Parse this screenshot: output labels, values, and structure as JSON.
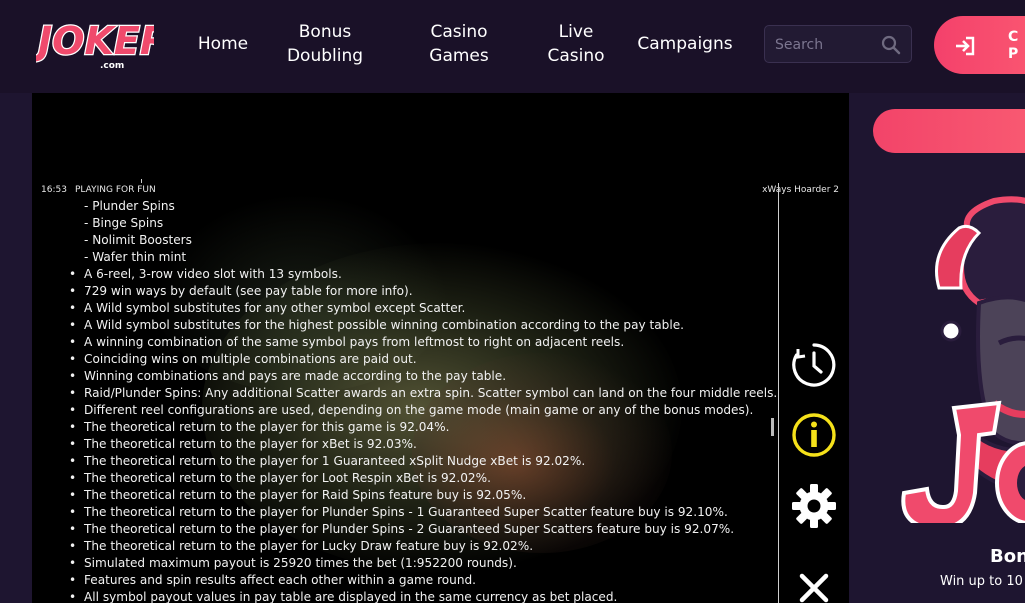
{
  "brand": {
    "logo_text": "JOKERI",
    "logo_sub": ".com"
  },
  "nav": {
    "items": [
      {
        "label": "Home"
      },
      {
        "label": "Bonus\nDoubling"
      },
      {
        "label": "Casino\nGames"
      },
      {
        "label": "Live\nCasino"
      },
      {
        "label": "Campaigns"
      }
    ]
  },
  "search": {
    "placeholder": "Search",
    "value": ""
  },
  "login": {
    "label": "C\nP"
  },
  "game": {
    "time": "16:53",
    "mode": "PLAYING FOR FUN",
    "title": "xWays Hoarder 2",
    "sub_items": [
      "- Plunder Spins",
      "- Binge Spins",
      "- Nolimit Boosters",
      "- Wafer thin mint"
    ],
    "rules": [
      "A 6-reel, 3-row video slot with 13 symbols.",
      "729 win ways by default (see pay table for more info).",
      "A Wild symbol substitutes for any other symbol except Scatter.",
      "A Wild symbol substitutes for the highest possible winning combination according to the pay table.",
      "A winning combination of the same symbol pays from leftmost to right on adjacent reels.",
      "Coinciding wins on multiple combinations are paid out.",
      "Winning combinations and pays are made according to the pay table.",
      "Raid/Plunder Spins: Any additional Scatter awards an extra spin. Scatter symbol can land on the four middle reels.",
      "Different reel configurations are used, depending on the game mode (main game or any of the bonus modes).",
      "The theoretical return to the player for this game is 92.04%.",
      "The theoretical return to the player for xBet is 92.03%.",
      "The theoretical return to the player for 1 Guaranteed xSplit Nudge xBet is 92.02%.",
      "The theoretical return to the player for Loot Respin xBet is 92.02%.",
      "The theoretical return to the player for Raid Spins feature buy is 92.05%.",
      "The theoretical return to the player for Plunder Spins - 1 Guaranteed Super Scatter feature buy is 92.10%.",
      "The theoretical return to the player for Plunder Spins - 2 Guaranteed Super Scatters feature buy is 92.07%.",
      "The theoretical return to the player for Lucky Draw feature buy is 92.02%.",
      "Simulated maximum payout is 25920 times the bet (1:952200 rounds).",
      "Features and spin results affect each other within a game round.",
      "All symbol payout values in pay table are displayed in the same currency as bet placed."
    ],
    "icons": [
      "history-icon",
      "info-icon",
      "settings-icon",
      "close-icon"
    ]
  },
  "promo": {
    "title": "Bon",
    "subtitle": "Win up to 10"
  },
  "colors": {
    "accent": "#f4416b",
    "header_bg": "#1a1128",
    "page_bg": "#1e1530",
    "info_yellow": "#f5e11a"
  }
}
